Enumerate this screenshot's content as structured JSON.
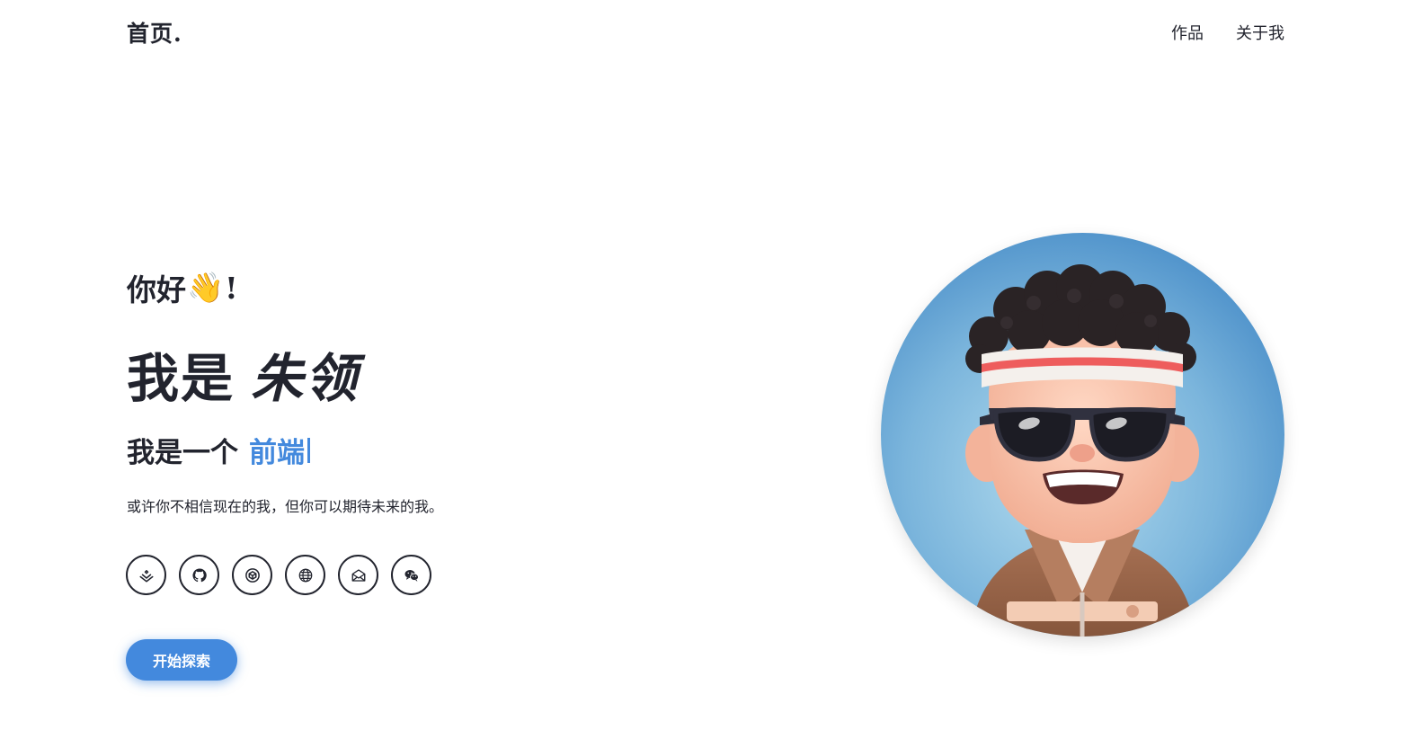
{
  "header": {
    "logo": "首页.",
    "nav": [
      {
        "label": "作品"
      },
      {
        "label": "关于我"
      }
    ]
  },
  "hero": {
    "greeting_text": "你好",
    "greeting_emoji": "👋",
    "greeting_suffix": "!",
    "headline_prefix": "我是",
    "headline_name": "朱领",
    "role_prefix": "我是一个",
    "role_typed": "前端",
    "tagline": "或许你不相信现在的我，但你可以期待未来的我。"
  },
  "socials": [
    {
      "icon": "juejin-icon"
    },
    {
      "icon": "github-icon"
    },
    {
      "icon": "codepen-icon"
    },
    {
      "icon": "globe-icon"
    },
    {
      "icon": "email-icon"
    },
    {
      "icon": "wechat-icon"
    }
  ],
  "cta": {
    "label": "开始探索"
  },
  "colors": {
    "accent": "#4389dd",
    "text": "#22242e"
  }
}
